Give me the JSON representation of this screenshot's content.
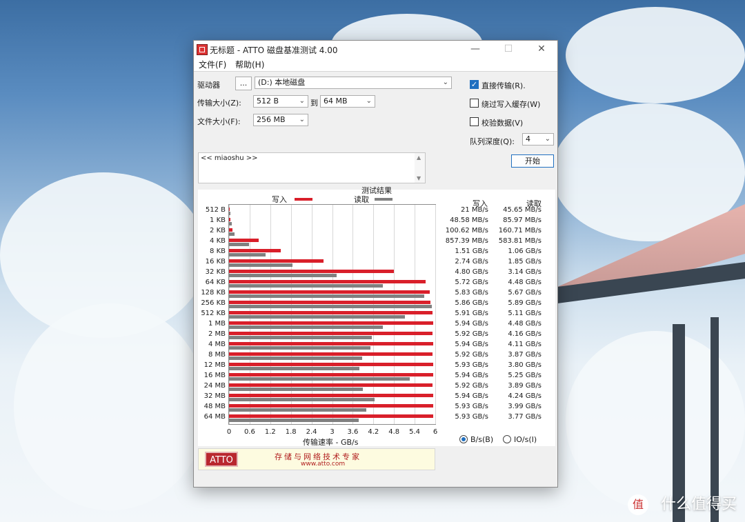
{
  "window": {
    "title": "无标题 - ATTO 磁盘基准测试 4.00",
    "controls": {
      "minimize": "—",
      "maximize": "☐",
      "close": "✕"
    }
  },
  "menu": {
    "file": "文件(F)",
    "help": "帮助(H)"
  },
  "form": {
    "drive_label": "驱动器",
    "browse_btn": "...",
    "drive_value": "(D:) 本地磁盘",
    "transfer_label": "传输大小(Z):",
    "transfer_from": "512 B",
    "to_label": "到",
    "transfer_to": "64 MB",
    "file_size_label": "文件大小(F):",
    "file_size": "256 MB",
    "direct_io": "直接传输(R).",
    "direct_io_checked": true,
    "bypass_cache": "绕过写入缓存(W)",
    "bypass_cache_checked": false,
    "verify": "校验数据(V)",
    "verify_checked": false,
    "queue_label": "队列深度(Q):",
    "queue_value": "4",
    "start_btn": "开始",
    "notes": "<< miaoshu >>"
  },
  "results": {
    "title": "测试结果",
    "legend_write": "写入",
    "legend_read": "读取",
    "col_write": "写入",
    "col_read": "读取",
    "xlabel": "传输速率 - GB/s",
    "radio_bps": "B/s(B)",
    "radio_ios": "IO/s(I)",
    "radio_bps_selected": true
  },
  "banner": {
    "logo": "ATTO",
    "slogan": "存储与网络技术专家",
    "site": "www.atto.com"
  },
  "watermark": {
    "badge": "值",
    "text": "什么值得买"
  },
  "colors": {
    "write": "#d91f2a",
    "read": "#808080",
    "accent": "#1f6fc0"
  },
  "chart_data": {
    "type": "bar",
    "orientation": "horizontal",
    "title": "测试结果",
    "xlabel": "传输速率 - GB/s",
    "xlim": [
      0,
      6
    ],
    "xticks": [
      "0",
      "0.6",
      "1.2",
      "1.8",
      "2.4",
      "3",
      "3.6",
      "4.2",
      "4.8",
      "5.4",
      "6"
    ],
    "grid": true,
    "categories": [
      "512 B",
      "1 KB",
      "2 KB",
      "4 KB",
      "8 KB",
      "16 KB",
      "32 KB",
      "64 KB",
      "128 KB",
      "256 KB",
      "512 KB",
      "1 MB",
      "2 MB",
      "4 MB",
      "8 MB",
      "12 MB",
      "16 MB",
      "24 MB",
      "32 MB",
      "48 MB",
      "64 MB"
    ],
    "series": [
      {
        "name": "写入",
        "values": [
          0.021,
          0.04858,
          0.10062,
          0.85739,
          1.51,
          2.74,
          4.8,
          5.72,
          5.83,
          5.86,
          5.91,
          5.94,
          5.92,
          5.94,
          5.92,
          5.93,
          5.94,
          5.92,
          5.94,
          5.93,
          5.93
        ]
      },
      {
        "name": "读取",
        "values": [
          0.04565,
          0.08597,
          0.16071,
          0.58381,
          1.06,
          1.85,
          3.14,
          4.48,
          5.67,
          5.89,
          5.11,
          4.48,
          4.16,
          4.11,
          3.87,
          3.8,
          5.25,
          3.89,
          4.24,
          3.99,
          3.77
        ]
      }
    ],
    "write_text": [
      "21 MB/s",
      "48.58 MB/s",
      "100.62 MB/s",
      "857.39 MB/s",
      "1.51 GB/s",
      "2.74 GB/s",
      "4.80 GB/s",
      "5.72 GB/s",
      "5.83 GB/s",
      "5.86 GB/s",
      "5.91 GB/s",
      "5.94 GB/s",
      "5.92 GB/s",
      "5.94 GB/s",
      "5.92 GB/s",
      "5.93 GB/s",
      "5.94 GB/s",
      "5.92 GB/s",
      "5.94 GB/s",
      "5.93 GB/s",
      "5.93 GB/s"
    ],
    "read_text": [
      "45.65 MB/s",
      "85.97 MB/s",
      "160.71 MB/s",
      "583.81 MB/s",
      "1.06 GB/s",
      "1.85 GB/s",
      "3.14 GB/s",
      "4.48 GB/s",
      "5.67 GB/s",
      "5.89 GB/s",
      "5.11 GB/s",
      "4.48 GB/s",
      "4.16 GB/s",
      "4.11 GB/s",
      "3.87 GB/s",
      "3.80 GB/s",
      "5.25 GB/s",
      "3.89 GB/s",
      "4.24 GB/s",
      "3.99 GB/s",
      "3.77 GB/s"
    ]
  }
}
